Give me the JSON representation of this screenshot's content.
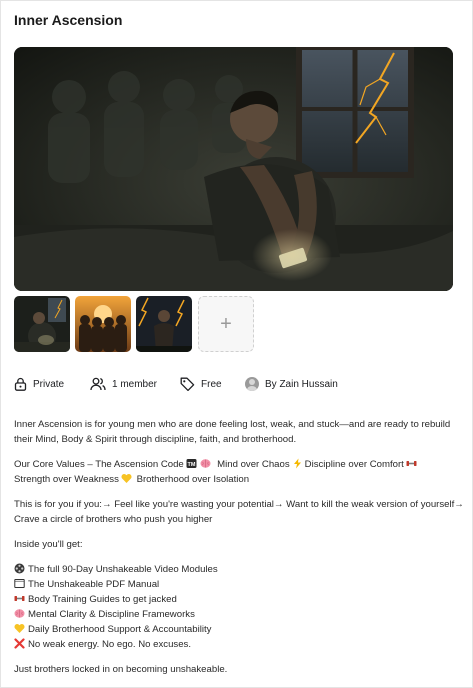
{
  "group": {
    "title": "Inner Ascension"
  },
  "meta": {
    "privacy": "Private",
    "members": "1 member",
    "price": "Free",
    "owner": "By Zain Hussain"
  },
  "description": {
    "intro": "Inner Ascension is for young men who are done feeling lost, weak, and stuck—and are ready to rebuild their Mind, Body & Spirit through discipline, faith, and brotherhood.",
    "values_prefix": "Our Core Values – The Ascension Code",
    "values": [
      "Mind over Chaos",
      "Discipline over Comfort",
      "Strength over Weakness",
      "Brotherhood over Isolation"
    ],
    "for_you": "This is for you if you:→ Feel like you're wasting your potential→ Want to kill the weak version of yourself→ Crave a circle of brothers who push you higher",
    "inside_heading": "Inside you'll get:",
    "inside_items": [
      {
        "icon": "film-reel-icon",
        "text": "The full 90-Day Unshakeable Video Modules"
      },
      {
        "icon": "book-icon",
        "text": "The Unshakeable PDF Manual"
      },
      {
        "icon": "dumbbell-icon",
        "text": "Body Training Guides to get jacked"
      },
      {
        "icon": "brain-icon",
        "text": "Mental Clarity & Discipline Frameworks"
      },
      {
        "icon": "yellow-heart-icon",
        "text": "Daily Brotherhood Support & Accountability"
      },
      {
        "icon": "red-x-icon",
        "text": "No weak energy. No ego. No excuses."
      }
    ],
    "closing": "Just brothers locked in on becoming unshakeable."
  },
  "colors": {
    "text": "#202124",
    "brain": "#f28fa6",
    "lightning": "#f5b800",
    "heart": "#f7c325",
    "cross": "#e53935"
  }
}
